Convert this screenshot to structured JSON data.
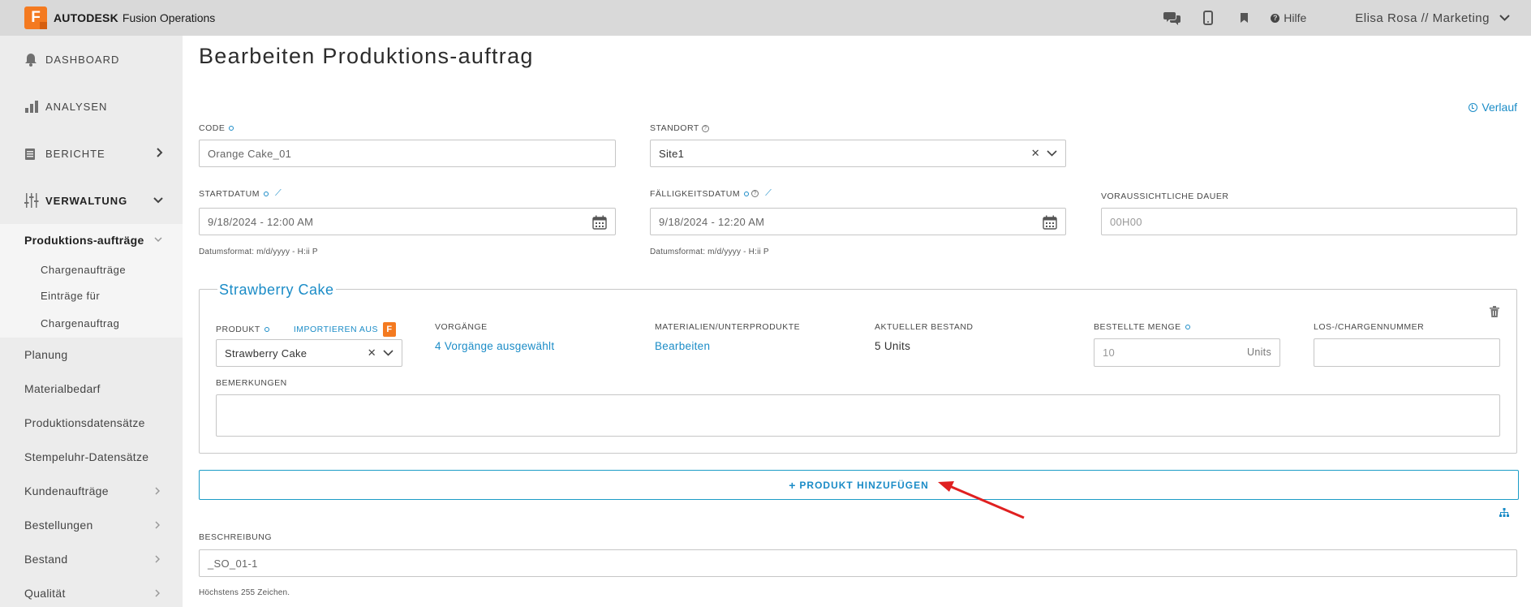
{
  "app": {
    "brand_strong": "AUTODESK",
    "brand_light": "Fusion Operations",
    "logo_letter": "F",
    "help_label": "Hilfe",
    "user_label": "Elisa Rosa // Marketing",
    "icons": [
      "chat-icon",
      "mobile-icon",
      "bookmark-icon",
      "help-icon"
    ]
  },
  "sidebar": {
    "main": [
      {
        "label": "DASHBOARD",
        "icon": "bell-icon"
      },
      {
        "label": "ANALYSEN",
        "icon": "bar-chart-icon"
      },
      {
        "label": "BERICHTE",
        "icon": "report-icon"
      },
      {
        "label": "VERWALTUNG",
        "icon": "sliders-icon"
      }
    ],
    "active_sub": "Produktions-aufträge",
    "subsub": [
      "Chargenaufträge",
      "Einträge für",
      "Chargenauftrag"
    ],
    "items": [
      "Planung",
      "Materialbedarf",
      "Produktionsdatensätze",
      "Stempeluhr-Datensätze",
      "Kundenaufträge",
      "Bestellungen",
      "Bestand",
      "Qualität"
    ]
  },
  "page": {
    "title": "Bearbeiten Produktions-auftrag",
    "history_link": "Verlauf"
  },
  "form": {
    "code_label": "CODE",
    "code_value": "Orange Cake_01",
    "standort_label": "STANDORT",
    "standort_value": "Site1",
    "start_label": "STARTDATUM",
    "start_value": "9/18/2024 - 12:00 AM",
    "start_hint": "Datumsformat: m/d/yyyy - H:ii P",
    "due_label": "FÄLLIGKEITSDATUM",
    "due_value": "9/18/2024 - 12:20 AM",
    "due_hint": "Datumsformat: m/d/yyyy - H:ii P",
    "duration_label": "VORAUSSICHTLICHE DAUER",
    "duration_placeholder": "00H00",
    "beschreibung_label": "BESCHREIBUNG",
    "beschreibung_value": "_SO_01-1",
    "beschreibung_hint": "Höchstens 255 Zeichen."
  },
  "product": {
    "legend": "Strawberry Cake",
    "produkt_label": "PRODUKT",
    "import_label": "IMPORTIEREN AUS",
    "produkt_value": "Strawberry Cake",
    "vorgaenge_label": "VORGÄNGE",
    "vorgaenge_value": "4 Vorgänge ausgewählt",
    "materialien_label": "MATERIALIEN/UNTERPRODUKTE",
    "materialien_value": "Bearbeiten",
    "bestand_label": "AKTUELLER BESTAND",
    "bestand_value": "5 Units",
    "menge_label": "BESTELLTE MENGE",
    "menge_placeholder": "10",
    "menge_unit": "Units",
    "los_label": "LOS-/CHARGENNUMMER",
    "bemerkungen_label": "BEMERKUNGEN"
  },
  "actions": {
    "add_product": "PRODUKT HINZUFÜGEN"
  },
  "colors": {
    "accent": "#1b8cc7",
    "brand": "#f47a20",
    "annotation_arrow": "#e02020"
  }
}
